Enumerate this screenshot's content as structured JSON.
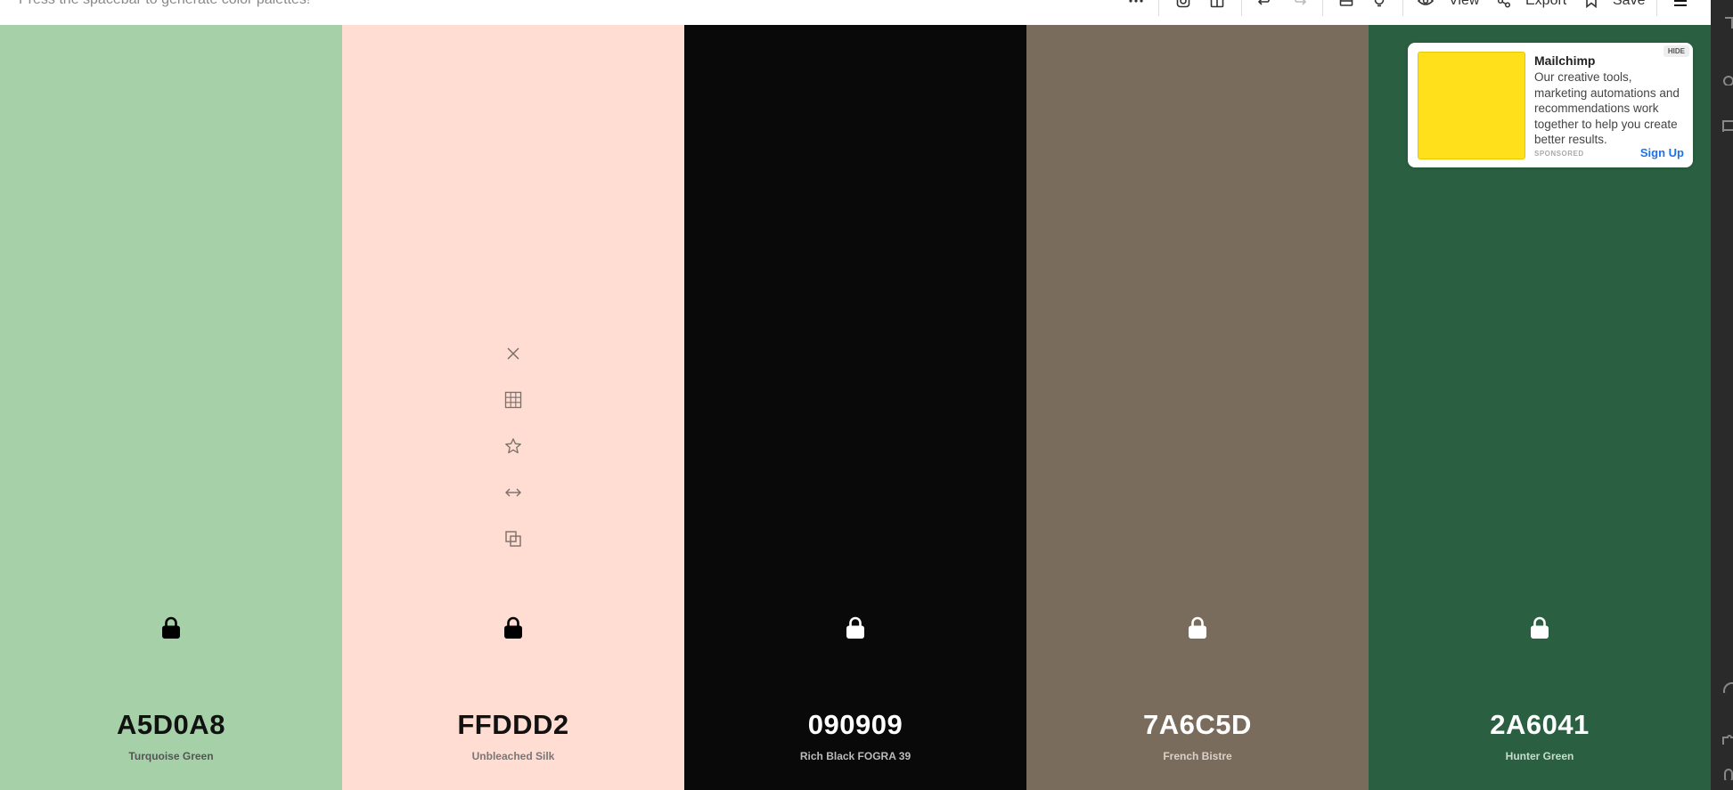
{
  "toolbar": {
    "hint": "Press the spacebar to generate color palettes!",
    "view_label": "View",
    "export_label": "Export",
    "save_label": "Save"
  },
  "palette": [
    {
      "hex": "A5D0A8",
      "name": "Turquoise Green",
      "bg": "#A5D0A8",
      "fg": "#111111",
      "sub": "#555555"
    },
    {
      "hex": "FFDDD2",
      "name": "Unbleached Silk",
      "bg": "#FFDDD2",
      "fg": "#111111",
      "sub": "#777777"
    },
    {
      "hex": "090909",
      "name": "Rich Black FOGRA 39",
      "bg": "#090909",
      "fg": "#ffffff",
      "sub": "#bbbbbb"
    },
    {
      "hex": "7A6C5D",
      "name": "French Bistre",
      "bg": "#7A6C5D",
      "fg": "#ffffff",
      "sub": "#d8d2cb"
    },
    {
      "hex": "2A6041",
      "name": "Hunter Green",
      "bg": "#2A6041",
      "fg": "#ffffff",
      "sub": "#c9dccf"
    }
  ],
  "ad": {
    "title": "Mailchimp",
    "body": "Our creative tools, marketing automations and recommendations work together to help you create better results.",
    "sponsored": "SPONSORED",
    "cta": "Sign Up",
    "hide": "HIDE"
  }
}
